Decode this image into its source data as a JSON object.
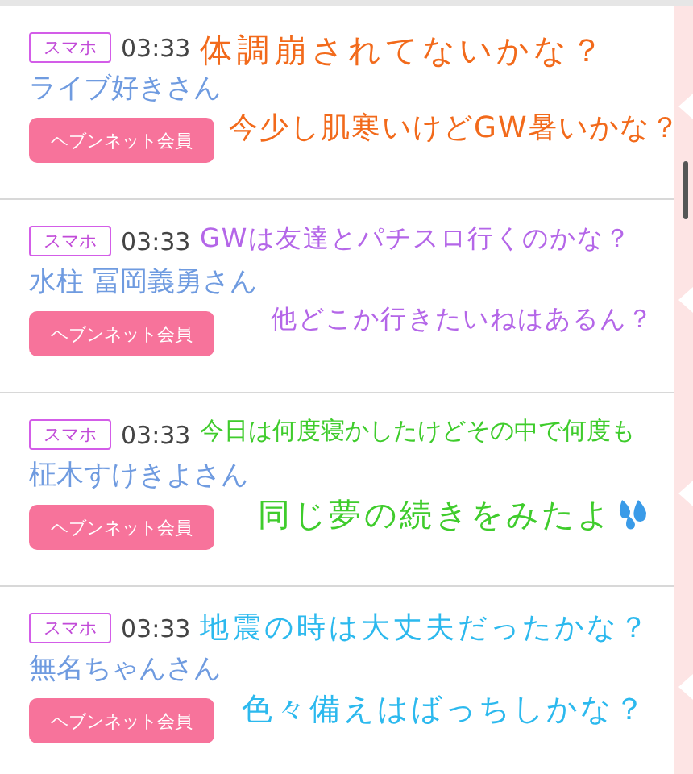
{
  "posts": [
    {
      "device": "スマホ",
      "time": "03:33",
      "name": "ライブ好きさん",
      "button": "ヘブンネット会員",
      "message": {
        "color": "#f26a1b",
        "lines": [
          "体調崩されてないかな？",
          "今少し肌寒いけどGW暑いかな？"
        ]
      }
    },
    {
      "device": "スマホ",
      "time": "03:33",
      "name": "水柱 冨岡義勇さん",
      "button": "ヘブンネット会員",
      "message": {
        "color": "#b466e8",
        "lines": [
          "GWは友達とパチスロ行くのかな？",
          "他どこか行きたいねはあるん？"
        ]
      }
    },
    {
      "device": "スマホ",
      "time": "03:33",
      "name": "柾木すけきよさん",
      "button": "ヘブンネット会員",
      "message": {
        "color": "#3fcc2c",
        "lines": [
          "今日は何度寝かしたけどその中で何度も",
          "同じ夢の続きをみたよ"
        ],
        "emoji": true
      }
    },
    {
      "device": "スマホ",
      "time": "03:33",
      "name": "無名ちゃんさん",
      "button": "ヘブンネット会員",
      "message": {
        "color": "#2cb9ee",
        "lines": [
          "地震の時は大丈夫だったかな？",
          "色々備えはばっちしかな？"
        ]
      }
    }
  ]
}
